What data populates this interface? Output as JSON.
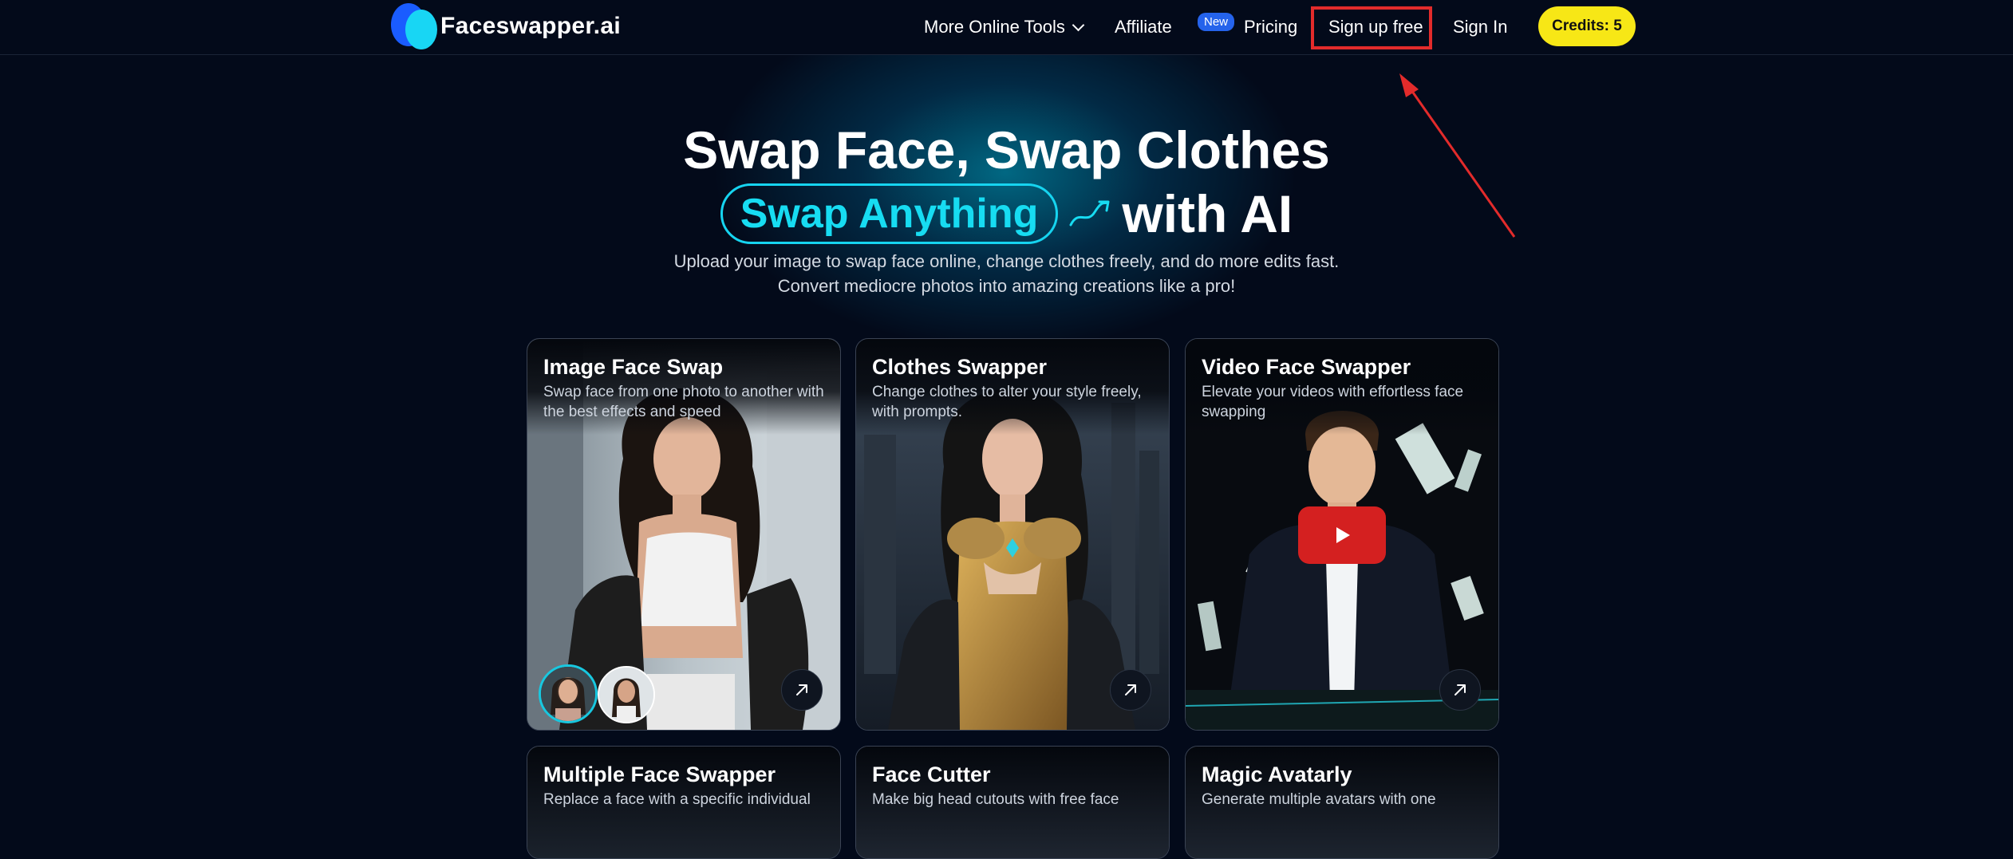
{
  "brand": {
    "name": "Faceswapper.ai"
  },
  "nav": {
    "more_tools": "More Online Tools",
    "affiliate": "Affiliate",
    "affiliate_badge": "New",
    "pricing": "Pricing",
    "signup": "Sign up free",
    "signin": "Sign In",
    "credits": "Credits: 5"
  },
  "hero": {
    "title_line1": "Swap Face, Swap Clothes",
    "highlight": "Swap Anything",
    "title_suffix": "with AI",
    "subtitle_line1": "Upload your image to swap face online, change clothes freely, and do more edits fast.",
    "subtitle_line2": "Convert mediocre photos into amazing creations like a pro!"
  },
  "cards": [
    {
      "title": "Image Face Swap",
      "desc": "Swap face from one photo to another with the best effects and speed"
    },
    {
      "title": "Clothes Swapper",
      "desc": "Change clothes to alter your style freely, with prompts."
    },
    {
      "title": "Video Face Swapper",
      "desc": "Elevate your videos with effortless face swapping"
    },
    {
      "title": "Multiple Face Swapper",
      "desc": "Replace a face with a specific individual"
    },
    {
      "title": "Face Cutter",
      "desc": "Make big head cutouts with free face"
    },
    {
      "title": "Magic Avatarly",
      "desc": "Generate multiple avatars with one"
    }
  ],
  "colors": {
    "accent": "#17dcf2",
    "credits_bg": "#f7e716",
    "highlight_box": "#e32b2b",
    "background": "#030a1a"
  },
  "icons": [
    "chevron-down-icon",
    "arrow-up-right-icon",
    "play-icon",
    "swoosh-arrow-icon"
  ]
}
